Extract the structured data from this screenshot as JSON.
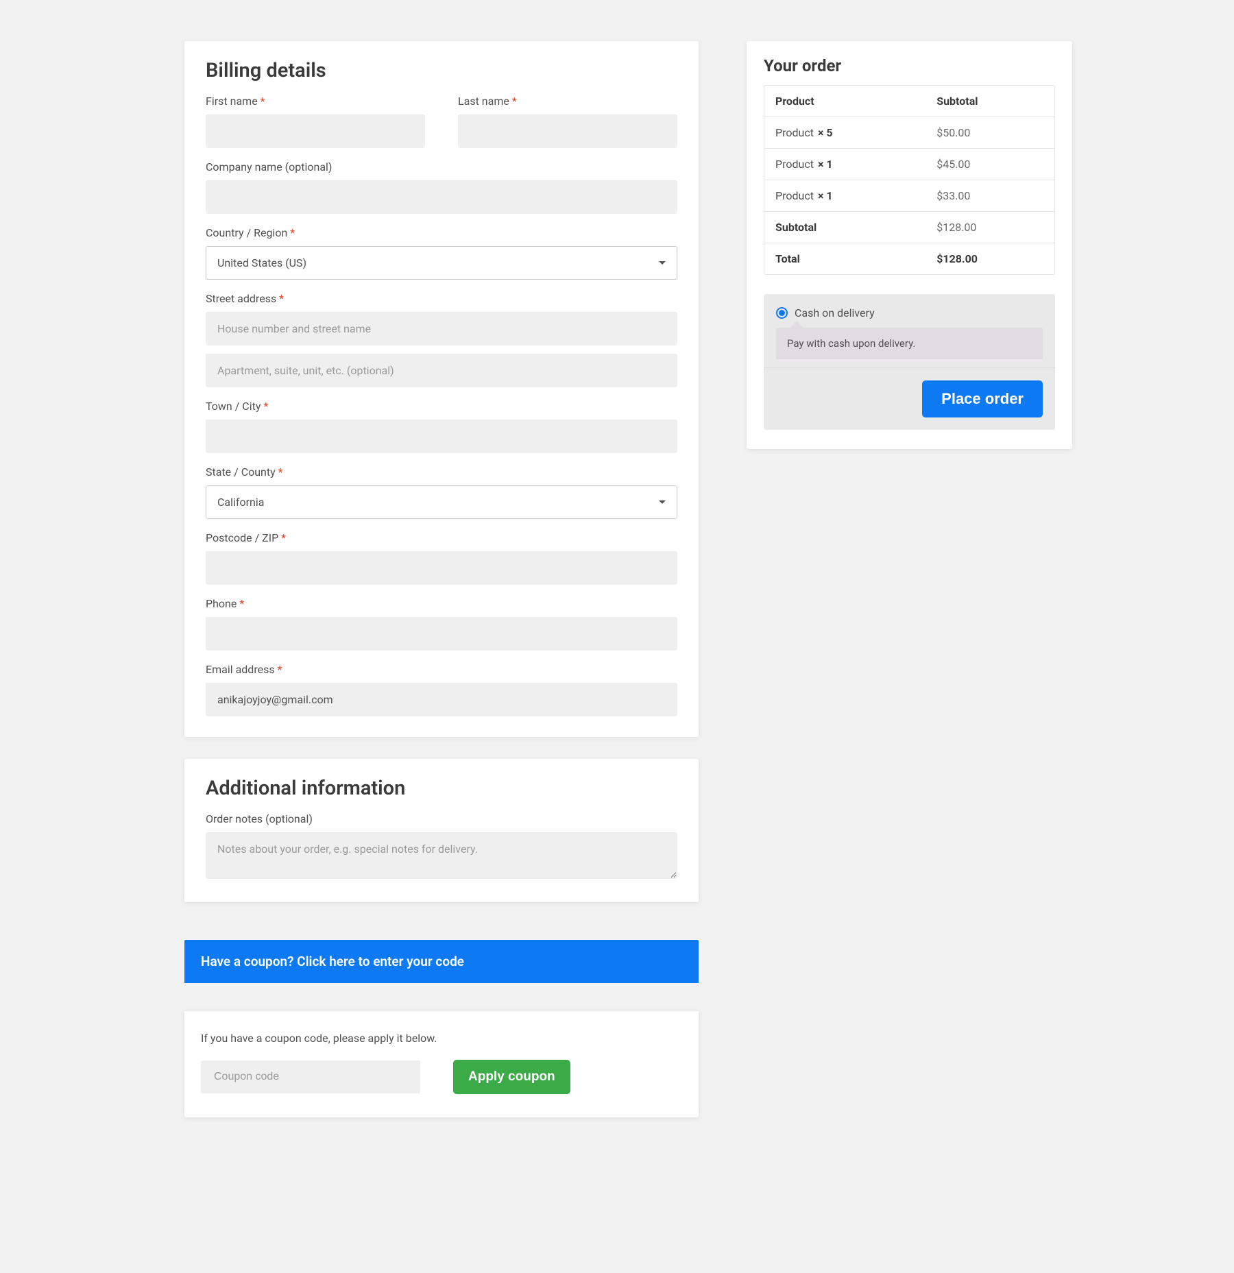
{
  "billing": {
    "heading": "Billing details",
    "first_name_label": "First name",
    "last_name_label": "Last name",
    "company_label": "Company name (optional)",
    "country_label": "Country / Region",
    "country_value": "United States (US)",
    "street_label": "Street address",
    "street1_placeholder": "House number and street name",
    "street2_placeholder": "Apartment, suite, unit, etc. (optional)",
    "city_label": "Town / City",
    "state_label": "State / County",
    "state_value": "California",
    "postcode_label": "Postcode / ZIP",
    "phone_label": "Phone",
    "email_label": "Email address",
    "email_value": "anikajoyjoy@gmail.com",
    "required_mark": "*"
  },
  "additional": {
    "heading": "Additional information",
    "notes_label": "Order notes (optional)",
    "notes_placeholder": "Notes about your order, e.g. special notes for delivery."
  },
  "coupon": {
    "banner": "Have a coupon? Click here to enter your code",
    "prompt": "If you have a coupon code, please apply it below.",
    "input_placeholder": "Coupon code",
    "apply_label": "Apply coupon"
  },
  "order": {
    "heading": "Your order",
    "col_product": "Product",
    "col_subtotal": "Subtotal",
    "items": [
      {
        "name": "Product",
        "qty": "× 5",
        "price": "$50.00"
      },
      {
        "name": "Product",
        "qty": "× 1",
        "price": "$45.00"
      },
      {
        "name": "Product",
        "qty": "× 1",
        "price": "$33.00"
      }
    ],
    "subtotal_label": "Subtotal",
    "subtotal_value": "$128.00",
    "total_label": "Total",
    "total_value": "$128.00",
    "payment_method": "Cash on delivery",
    "payment_desc": "Pay with cash upon delivery.",
    "place_order_label": "Place order"
  }
}
